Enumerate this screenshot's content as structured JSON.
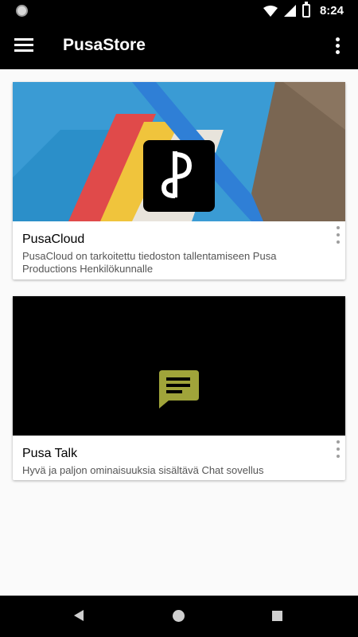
{
  "status_bar": {
    "time": "8:24"
  },
  "app_bar": {
    "title": "PusaStore"
  },
  "cards": [
    {
      "title": "PusaCloud",
      "description": "PusaCloud on tarkoitettu tiedoston tallentamiseen Pusa Productions Henkilökunnalle",
      "icon": "pusa-p-logo-icon"
    },
    {
      "title": "Pusa Talk",
      "description": "Hyvä ja paljon ominaisuuksia sisältävä Chat sovellus",
      "icon": "chat-bubble-icon"
    }
  ],
  "colors": {
    "app_bar": "#000000",
    "background": "#fafafa",
    "chat_icon": "#a0a43a"
  }
}
